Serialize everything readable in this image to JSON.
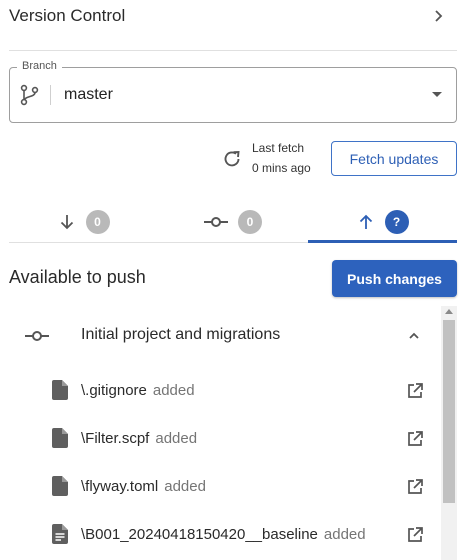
{
  "header": {
    "title": "Version Control"
  },
  "branch": {
    "legend": "Branch",
    "value": "master"
  },
  "fetch": {
    "label": "Last fetch",
    "time": "0 mins ago",
    "button": "Fetch updates"
  },
  "tabs": [
    {
      "icon": "arrow-down-icon",
      "badge": "0"
    },
    {
      "icon": "commit-icon",
      "badge": "0"
    },
    {
      "icon": "arrow-up-icon",
      "badge": "?"
    }
  ],
  "push": {
    "title": "Available to push",
    "button": "Push changes"
  },
  "commit": {
    "title": "Initial project and migrations",
    "files": [
      {
        "name": "\\.gitignore",
        "status": "added",
        "icon": "file-icon"
      },
      {
        "name": "\\Filter.scpf",
        "status": "added",
        "icon": "file-icon"
      },
      {
        "name": "\\flyway.toml",
        "status": "added",
        "icon": "file-icon"
      },
      {
        "name": "\\B001_20240418150420__baseline",
        "status": "added",
        "icon": "text-file-icon"
      }
    ]
  },
  "colors": {
    "accent": "#2d5fb5",
    "badge_grey": "#b9b9b9"
  }
}
